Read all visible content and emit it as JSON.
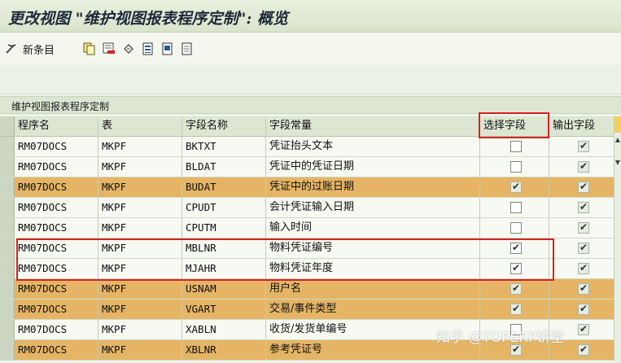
{
  "window": {
    "title": "更改视图 \"维护视图报表程序定制\": 概览"
  },
  "toolbar": {
    "new_entries_label": "新条目"
  },
  "table": {
    "title": "维护视图报表程序定制",
    "columns": [
      "程序名",
      "表",
      "字段名称",
      "字段常量",
      "选择字段",
      "输出字段"
    ],
    "rows": [
      {
        "program": "RM07DOCS",
        "table": "MKPF",
        "field": "BKTXT",
        "text": "凭证抬头文本",
        "select": false,
        "output": true,
        "highlight": false
      },
      {
        "program": "RM07DOCS",
        "table": "MKPF",
        "field": "BLDAT",
        "text": "凭证中的凭证日期",
        "select": false,
        "output": true,
        "highlight": false
      },
      {
        "program": "RM07DOCS",
        "table": "MKPF",
        "field": "BUDAT",
        "text": "凭证中的过账日期",
        "select": true,
        "output": true,
        "highlight": true
      },
      {
        "program": "RM07DOCS",
        "table": "MKPF",
        "field": "CPUDT",
        "text": "会计凭证输入日期",
        "select": false,
        "output": true,
        "highlight": false
      },
      {
        "program": "RM07DOCS",
        "table": "MKPF",
        "field": "CPUTM",
        "text": "输入时间",
        "select": false,
        "output": true,
        "highlight": false
      },
      {
        "program": "RM07DOCS",
        "table": "MKPF",
        "field": "MBLNR",
        "text": "物料凭证编号",
        "select": true,
        "output": true,
        "highlight": false
      },
      {
        "program": "RM07DOCS",
        "table": "MKPF",
        "field": "MJAHR",
        "text": "物料凭证年度",
        "select": true,
        "output": true,
        "highlight": false
      },
      {
        "program": "RM07DOCS",
        "table": "MKPF",
        "field": "USNAM",
        "text": "用户名",
        "select": true,
        "output": true,
        "highlight": true
      },
      {
        "program": "RM07DOCS",
        "table": "MKPF",
        "field": "VGART",
        "text": "交易/事件类型",
        "select": true,
        "output": true,
        "highlight": true
      },
      {
        "program": "RM07DOCS",
        "table": "MKPF",
        "field": "XABLN",
        "text": "收货/发货单编号",
        "select": false,
        "output": true,
        "highlight": false
      },
      {
        "program": "RM07DOCS",
        "table": "MKPF",
        "field": "XBLNR",
        "text": "参考凭证号",
        "select": true,
        "output": true,
        "highlight": true
      }
    ]
  },
  "watermark": "知乎 @TOPERP讲堂",
  "colors": {
    "highlight_row": "#e5b565",
    "annotation_red": "#d42222"
  },
  "icons": [
    "new-entries-icon",
    "copy-icon",
    "delete-icon",
    "undo-icon",
    "select-all-icon",
    "select-block-icon",
    "deselect-all-icon",
    "column-settings-icon"
  ]
}
